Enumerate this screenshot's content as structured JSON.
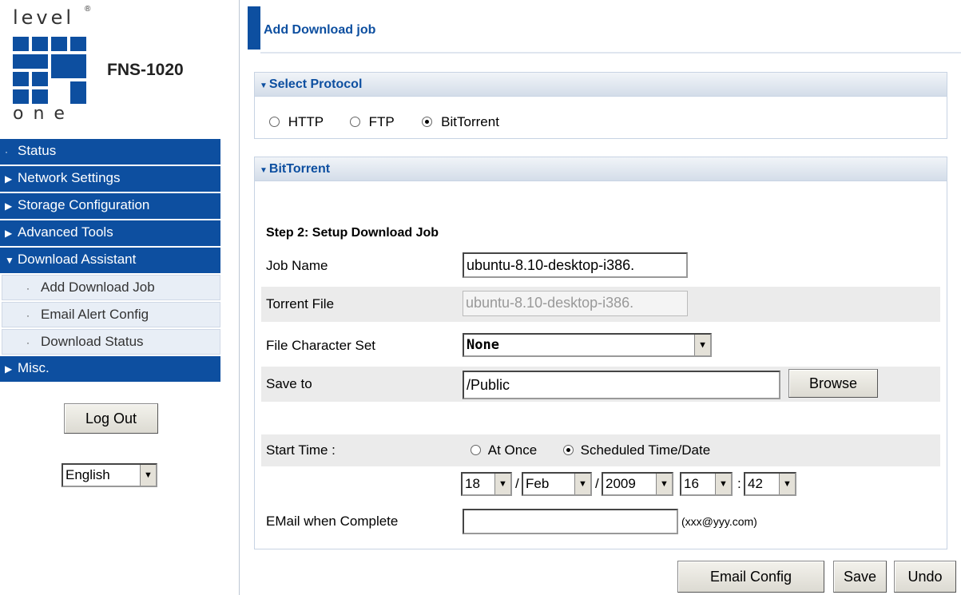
{
  "logo": {
    "top_word": "level",
    "registered": "®",
    "bottom_word": "one",
    "model": "FNS-1020"
  },
  "nav": {
    "status": "Status",
    "network": "Network Settings",
    "storage": "Storage Configuration",
    "advanced": "Advanced Tools",
    "download": "Download Assistant",
    "sub_add": "Add Download Job",
    "sub_email": "Email Alert Config",
    "sub_status": "Download Status",
    "misc": "Misc."
  },
  "sidebar": {
    "logout": "Log Out",
    "language": "English"
  },
  "header": {
    "title": "Add Download job"
  },
  "protocol": {
    "heading": "Select Protocol",
    "options": [
      "HTTP",
      "FTP",
      "BitTorrent"
    ],
    "selected": "BitTorrent"
  },
  "bittorrent": {
    "heading": "BitTorrent",
    "step": "Step 2: Setup Download Job",
    "job_name_label": "Job Name",
    "job_name_value": "ubuntu-8.10-desktop-i386.",
    "torrent_label": "Torrent File",
    "torrent_value": "ubuntu-8.10-desktop-i386.",
    "charset_label": "File Character Set",
    "charset_value": "None",
    "save_label": "Save to",
    "save_value": "/Public",
    "browse": "Browse",
    "start_label": "Start Time :",
    "at_once": "At Once",
    "scheduled": "Scheduled Time/Date",
    "start_mode": "scheduled",
    "day": "18",
    "month": "Feb",
    "year": "2009",
    "hour": "16",
    "minute": "42",
    "date_sep": "/",
    "time_sep": ":",
    "email_label": "EMail when Complete",
    "email_value": "",
    "email_hint": "(xxx@yyy.com)"
  },
  "actions": {
    "email_config": "Email Config",
    "save": "Save",
    "undo": "Undo"
  },
  "colors": {
    "brand_blue": "#0d4fa0",
    "sub_bg": "#e8eef6",
    "row_shade": "#ebebeb"
  }
}
